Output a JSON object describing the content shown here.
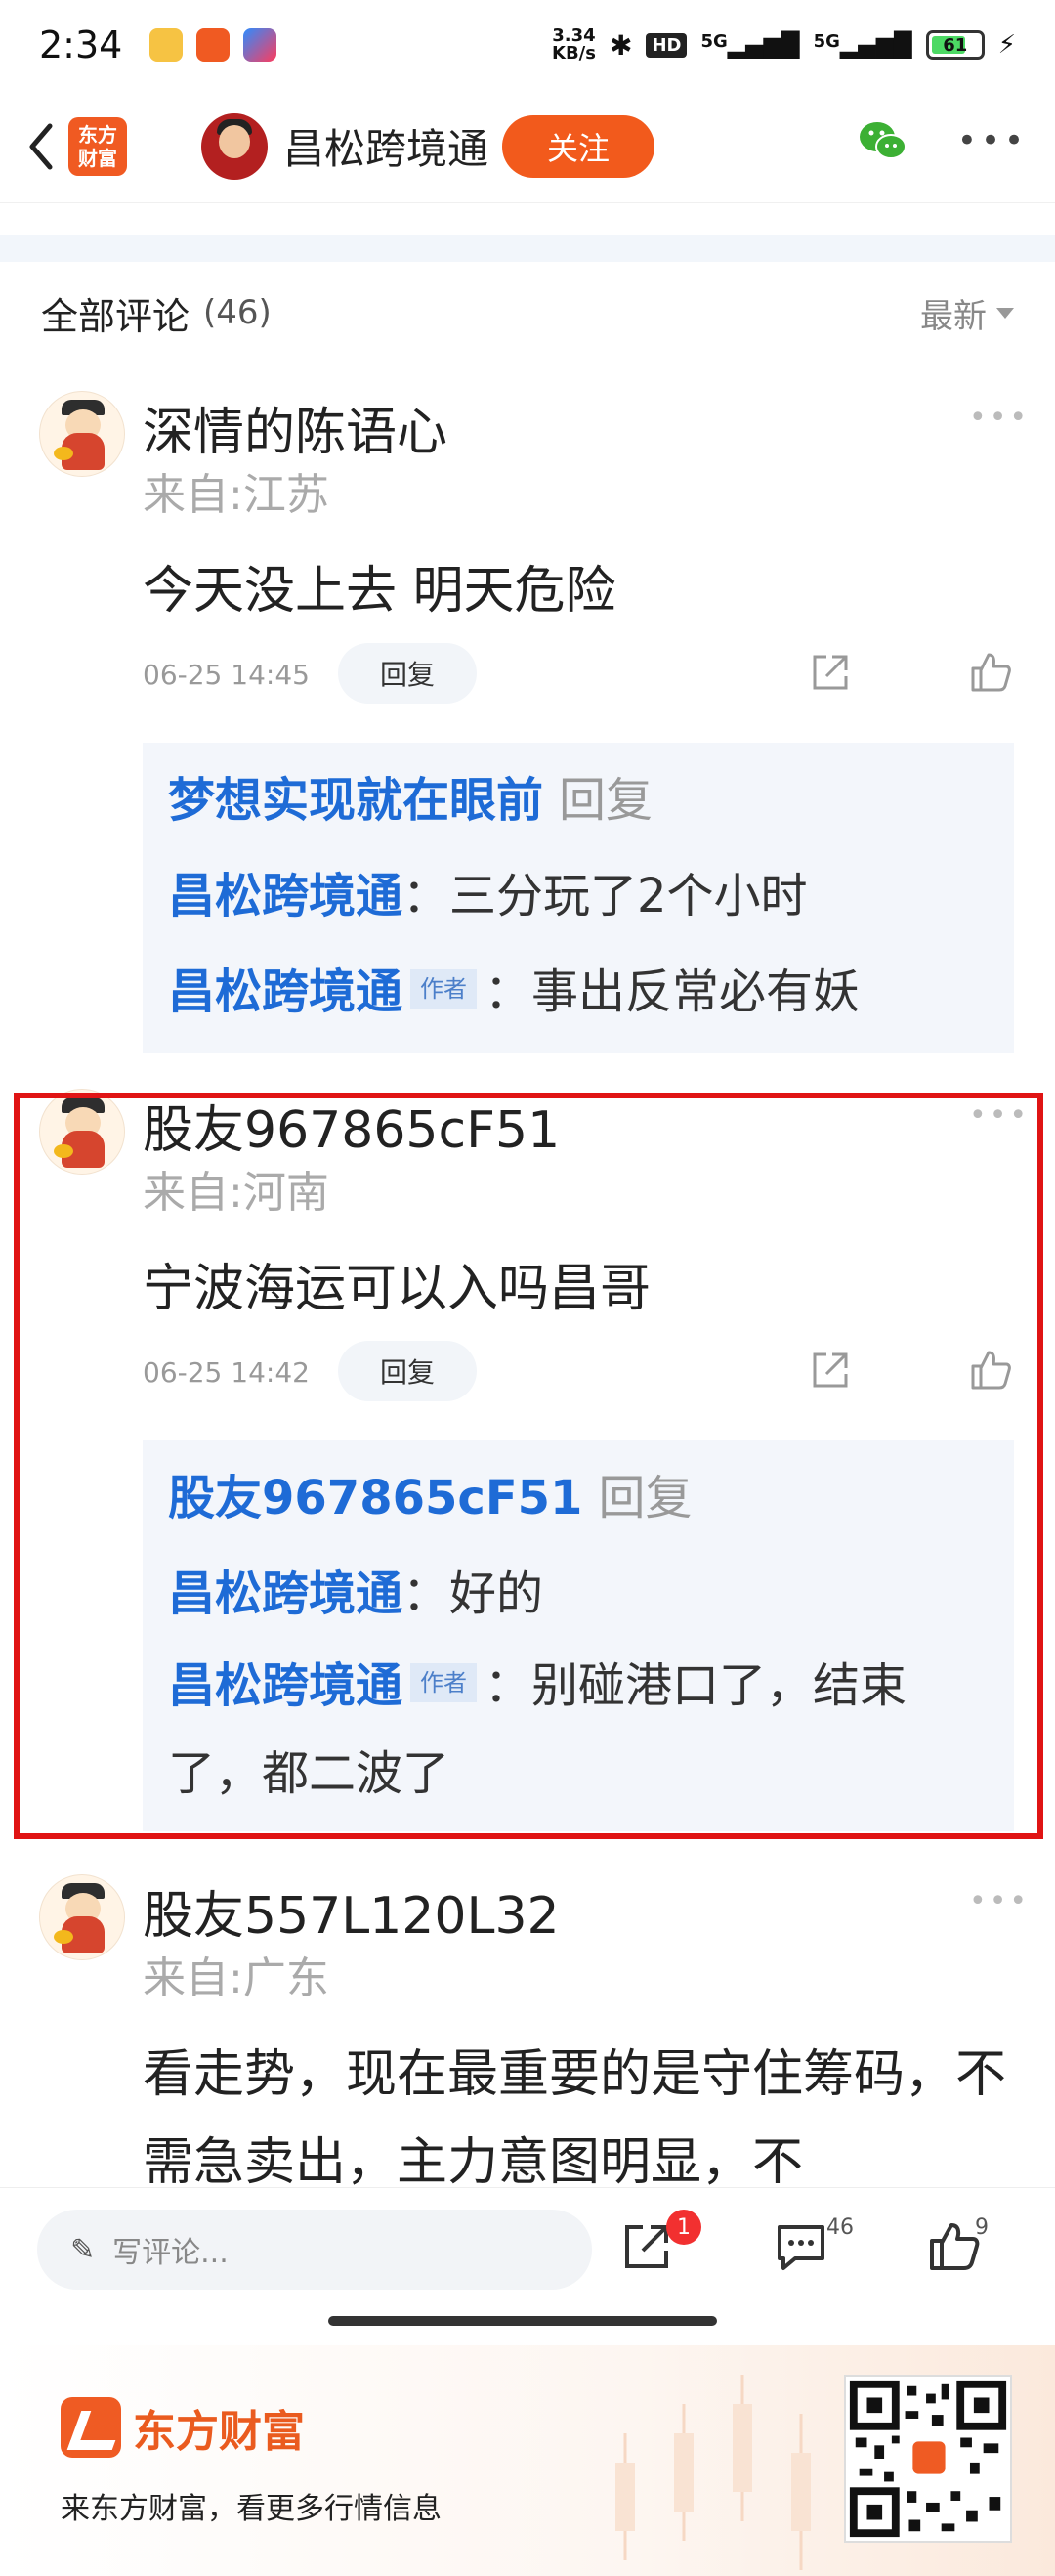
{
  "status_bar": {
    "time": "2:34",
    "net_speed": "3.34",
    "net_unit": "KB/s",
    "hd_label": "HD",
    "sim1": "5G",
    "sim2": "5G",
    "battery": "61"
  },
  "header": {
    "logo_text": "东方\n财富",
    "title": "昌松跨境通",
    "follow_label": "关注"
  },
  "comments_header": {
    "title": "全部评论",
    "count": "(46)",
    "sort_label": "最新"
  },
  "comments": [
    {
      "name": "深情的陈语心",
      "from": "来自:江苏",
      "text": "今天没上去  明天危险",
      "time": "06-25 14:45",
      "reply_label": "回复",
      "replies": [
        {
          "user": "梦想实现就在眼前",
          "suffix": "回复"
        },
        {
          "user": "昌松跨境通",
          "text": "：三分玩了2个小时"
        },
        {
          "user": "昌松跨境通",
          "tag": "作者",
          "text": "：事出反常必有妖"
        }
      ]
    },
    {
      "name": "股友967865cF51",
      "from": "来自:河南",
      "text": "宁波海运可以入吗昌哥",
      "time": "06-25 14:42",
      "reply_label": "回复",
      "replies": [
        {
          "user": "股友967865cF51",
          "suffix": "回复"
        },
        {
          "user": "昌松跨境通",
          "text": "：好的"
        },
        {
          "user": "昌松跨境通",
          "tag": "作者",
          "text": "：别碰港口了，结束了，都二波了"
        }
      ]
    },
    {
      "name": "股友557L120L32",
      "from": "来自:广东",
      "text": "看走势，现在最重要的是守住筹码，不需急卖出，主力意图明显，不"
    }
  ],
  "bottom_bar": {
    "input_placeholder": "写评论...",
    "share_badge": "1",
    "comment_count": "46",
    "like_count": "9"
  },
  "footer": {
    "brand": "东方财富",
    "slogan": "来东方财富，看更多行情信息"
  },
  "colors": {
    "accent": "#f25a1c",
    "link_blue": "#1e6bd6",
    "highlight_red": "#e01414"
  }
}
